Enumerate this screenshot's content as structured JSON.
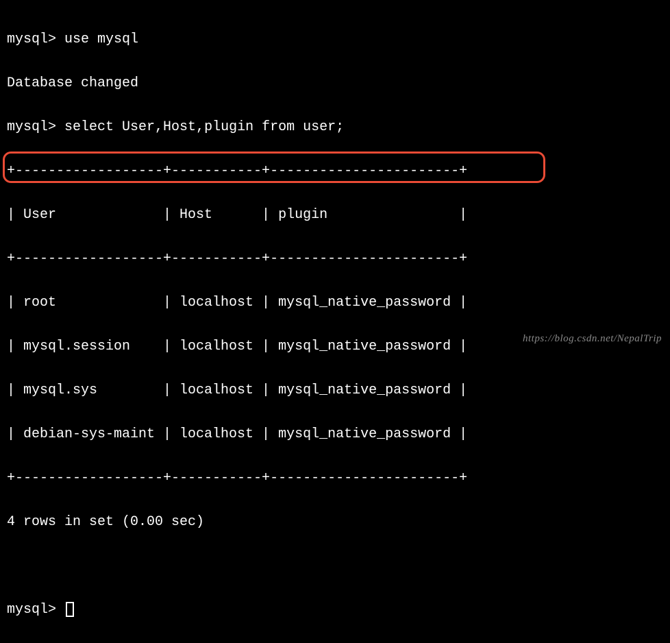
{
  "chart_data": {
    "type": "table",
    "title": "select User,Host,plugin from user",
    "columns": [
      "User",
      "Host",
      "plugin"
    ],
    "rows": [
      [
        "root",
        "localhost",
        "mysql_native_password"
      ],
      [
        "mysql.session",
        "localhost",
        "mysql_native_password"
      ],
      [
        "mysql.sys",
        "localhost",
        "mysql_native_password"
      ],
      [
        "debian-sys-maint",
        "localhost",
        "mysql_native_password"
      ]
    ]
  },
  "terminal": {
    "prompt": "mysql>",
    "cmd1": "use mysql",
    "response1": "Database changed",
    "cmd2": "select User,Host,plugin from user;",
    "border_top": "+------------------+-----------+-----------------------+",
    "header": "| User             | Host      | plugin                |",
    "border_mid": "+------------------+-----------+-----------------------+",
    "row1": "| root             | localhost | mysql_native_password |",
    "row2": "| mysql.session    | localhost | mysql_native_password |",
    "row3": "| mysql.sys        | localhost | mysql_native_password |",
    "row4": "| debian-sys-maint | localhost | mysql_native_password |",
    "border_bot": "+------------------+-----------+-----------------------+",
    "summary": "4 rows in set (0.00 sec)"
  },
  "watermark": "https://blog.csdn.net/NepalTrip"
}
